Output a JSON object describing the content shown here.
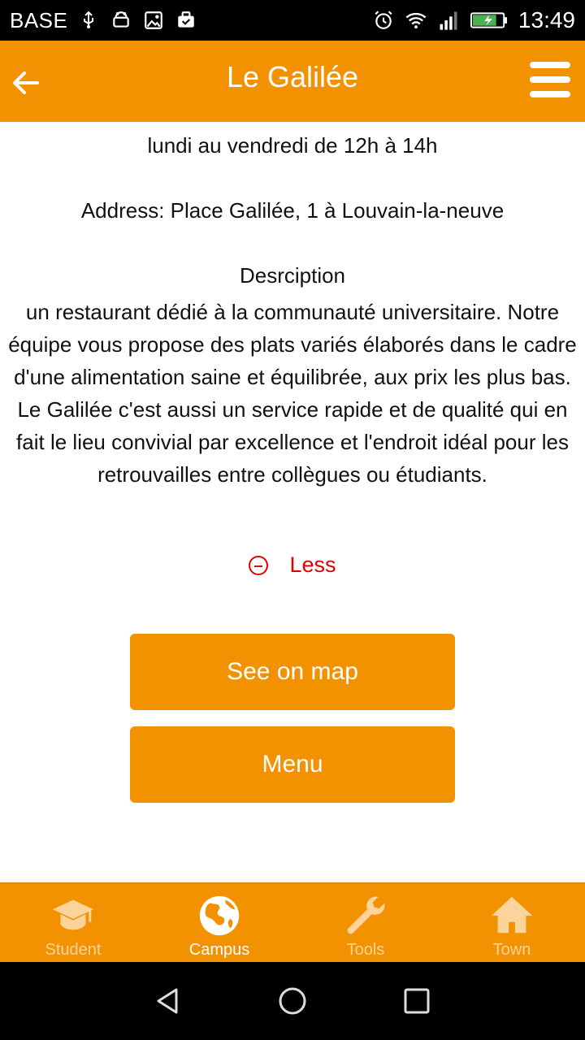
{
  "status_bar": {
    "carrier": "BASE",
    "time": "13:49",
    "left_icons": [
      "usb-icon",
      "android-icon",
      "image-icon",
      "briefcase-check-icon"
    ],
    "right_icons": [
      "alarm-icon",
      "wifi-icon",
      "signal-icon",
      "battery-charging-icon"
    ]
  },
  "app_bar": {
    "title": "Le Galilée",
    "back_icon": "arrow-left-icon",
    "menu_icon": "hamburger-menu-icon"
  },
  "content": {
    "hours": "lundi au vendredi de 12h à 14h",
    "address": "Address: Place Galilée, 1 à Louvain-la-neuve",
    "description_title": "Desrciption",
    "description_body": "un restaurant dédié à la communauté universitaire. Notre équipe vous propose des plats variés élaborés dans le cadre d'une alimentation saine et équilibrée, aux prix les plus bas. Le Galilée c'est aussi un service rapide et de qualité qui en fait le lieu convivial par excellence et l'endroit idéal pour les retrouvailles entre collègues ou étudiants.",
    "less_label": "Less"
  },
  "buttons": {
    "map_label": "See on map",
    "menu_label": "Menu"
  },
  "tabs": [
    {
      "label": "Student",
      "icon": "graduation-cap-icon",
      "active": false
    },
    {
      "label": "Campus",
      "icon": "globe-icon",
      "active": true
    },
    {
      "label": "Tools",
      "icon": "wrench-icon",
      "active": false
    },
    {
      "label": "Town",
      "icon": "home-icon",
      "active": false
    }
  ],
  "colors": {
    "accent": "#F29200",
    "link_red": "#E00000",
    "tab_inactive": "#FCD39A"
  }
}
